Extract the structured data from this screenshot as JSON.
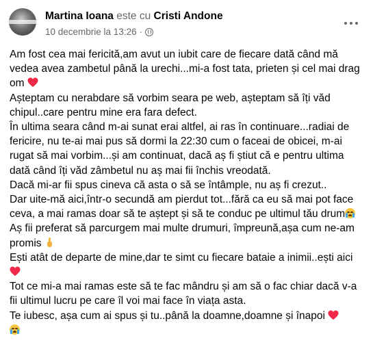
{
  "post": {
    "author": "Martina Ioana",
    "with_text": "este cu",
    "tagged": "Cristi Andone",
    "date": "10 decembrie la 13:26",
    "separator": "·",
    "privacy_icon": "globe-icon",
    "more_icon": "more-options-icon"
  },
  "body": {
    "p1a": "Am fost cea mai fericită,am avut un iubit care de fiecare dată când mă vedea avea zambetul până la urechi...mi-a fost tata, prieten și cel mai drag om ",
    "p2": "Așteptam cu nerabdare să vorbim seara pe web, așteptam să îți văd chipul..care pentru mine era fara defect.",
    "p3": "În ultima seara când m-ai sunat erai altfel, ai ras în continuare...radiai de fericire, nu te-ai mai pus să dormi la 22:30 cum o faceai de obicei, m-ai rugat să mai  vorbim...și am continuat, dacă aș fi știut că e pentru ultima dată când îți văd zâmbetul nu aș mai fii închis vreodată.",
    "p4": "Dacă mi-ar fii spus cineva că asta o să se întâmple, nu aș fi crezut..",
    "p5a": "Dar uite-mă aici,într-o secundă am pierdut tot...fără ca eu să mai pot face ceva, a mai ramas doar să te aștept și să te conduc pe ultimul tău drum",
    "p6a": "Aș fii preferat să parcurgem mai multe drumuri, împreună,așa cum ne-am promis ",
    "p7a": "Ești  atât de departe de mine,dar te simt cu fiecare bataie a inimii..ești aici ",
    "p8": "Tot ce mi-a mai ramas este să te fac mândru și am să o fac chiar dacă v-a fii ultimul lucru pe care îl voi mai face în viața asta.",
    "p9a": "Te iubesc, așa cum ai spus și tu..până la doamne,doamne și înapoi "
  },
  "colors": {
    "text": "#050505",
    "meta": "#65676b",
    "heart": "#f02849"
  }
}
